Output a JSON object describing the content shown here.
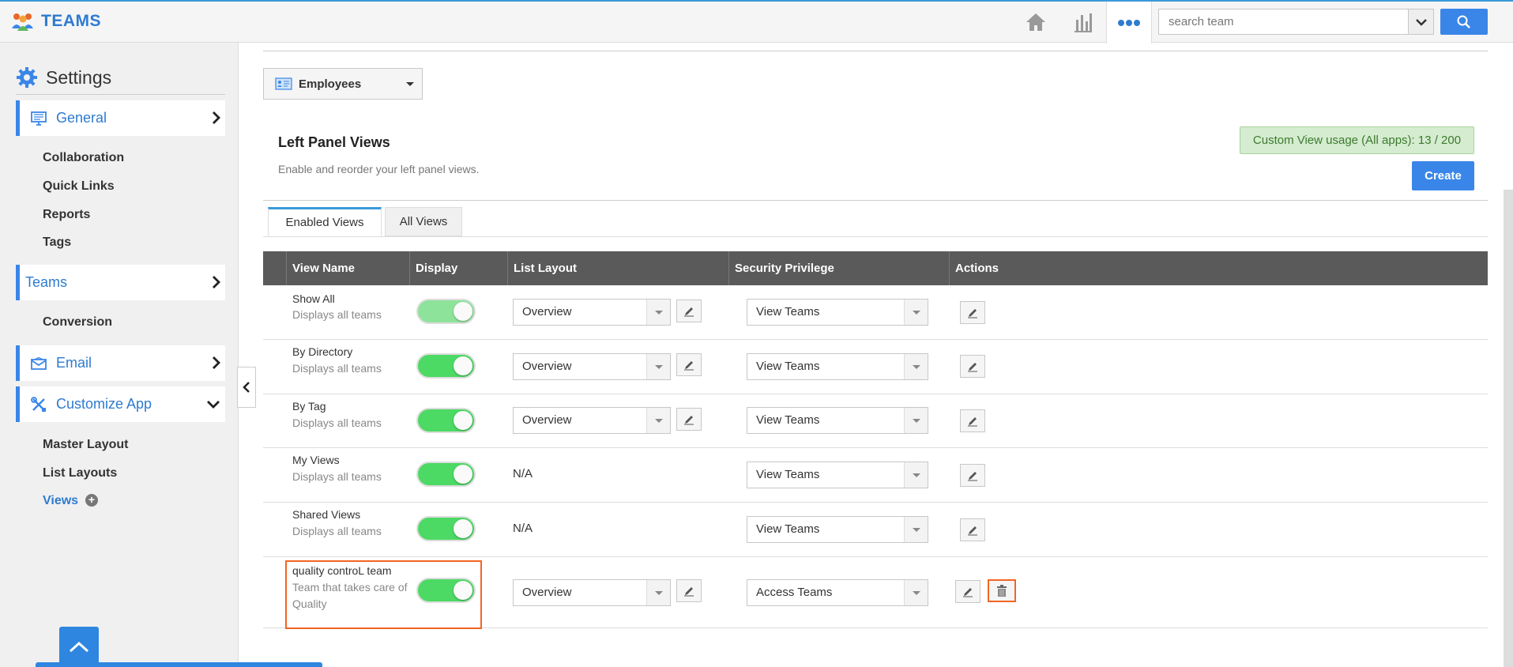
{
  "app": {
    "brand": "TEAMS"
  },
  "topbar": {
    "search_placeholder": "search team",
    "icons": [
      "home-icon",
      "bar-chart-icon",
      "more-icon",
      "chevron-down-icon",
      "search-icon"
    ]
  },
  "sidebar": {
    "title": "Settings",
    "sections": [
      {
        "label": "General",
        "icon": "monitor-icon",
        "expanded": false
      },
      {
        "label": "Teams",
        "icon": "",
        "expanded": false
      },
      {
        "label": "Email",
        "icon": "envelope-icon",
        "expanded": false
      },
      {
        "label": "Customize App",
        "icon": "tools-icon",
        "expanded": true
      }
    ],
    "general_items": [
      "Collaboration",
      "Quick Links",
      "Reports",
      "Tags"
    ],
    "teams_items": [
      "Conversion"
    ],
    "customize_items": [
      "Master Layout",
      "List Layouts",
      "Views"
    ]
  },
  "main": {
    "module_select": "Employees",
    "title": "Left Panel Views",
    "subtitle": "Enable and reorder your left panel views.",
    "usage": "Custom View usage (All apps): 13 / 200",
    "create": "Create",
    "tabs": [
      "Enabled Views",
      "All Views"
    ],
    "columns": [
      "View Name",
      "Display",
      "List Layout",
      "Security Privilege",
      "Actions"
    ],
    "rows": [
      {
        "name": "Show All",
        "desc": "Displays all teams",
        "display": true,
        "layout": "Overview",
        "security": "View Teams"
      },
      {
        "name": "By Directory",
        "desc": "Displays all teams",
        "display": true,
        "layout": "Overview",
        "security": "View Teams"
      },
      {
        "name": "By Tag",
        "desc": "Displays all teams",
        "display": true,
        "layout": "Overview",
        "security": "View Teams"
      },
      {
        "name": "My Views",
        "desc": "Displays all teams",
        "display": true,
        "layout": "N/A",
        "security": "View Teams"
      },
      {
        "name": "Shared Views",
        "desc": "Displays all teams",
        "display": true,
        "layout": "N/A",
        "security": "View Teams"
      },
      {
        "name": "quality controL team",
        "desc": "Team that takes care of Quality",
        "display": true,
        "layout": "Overview",
        "security": "Access Teams"
      }
    ]
  },
  "colors": {
    "accent": "#3a86e8",
    "toggle_on": "#4cd964",
    "highlight": "#f26522",
    "header_bg": "#5a5a5a"
  }
}
